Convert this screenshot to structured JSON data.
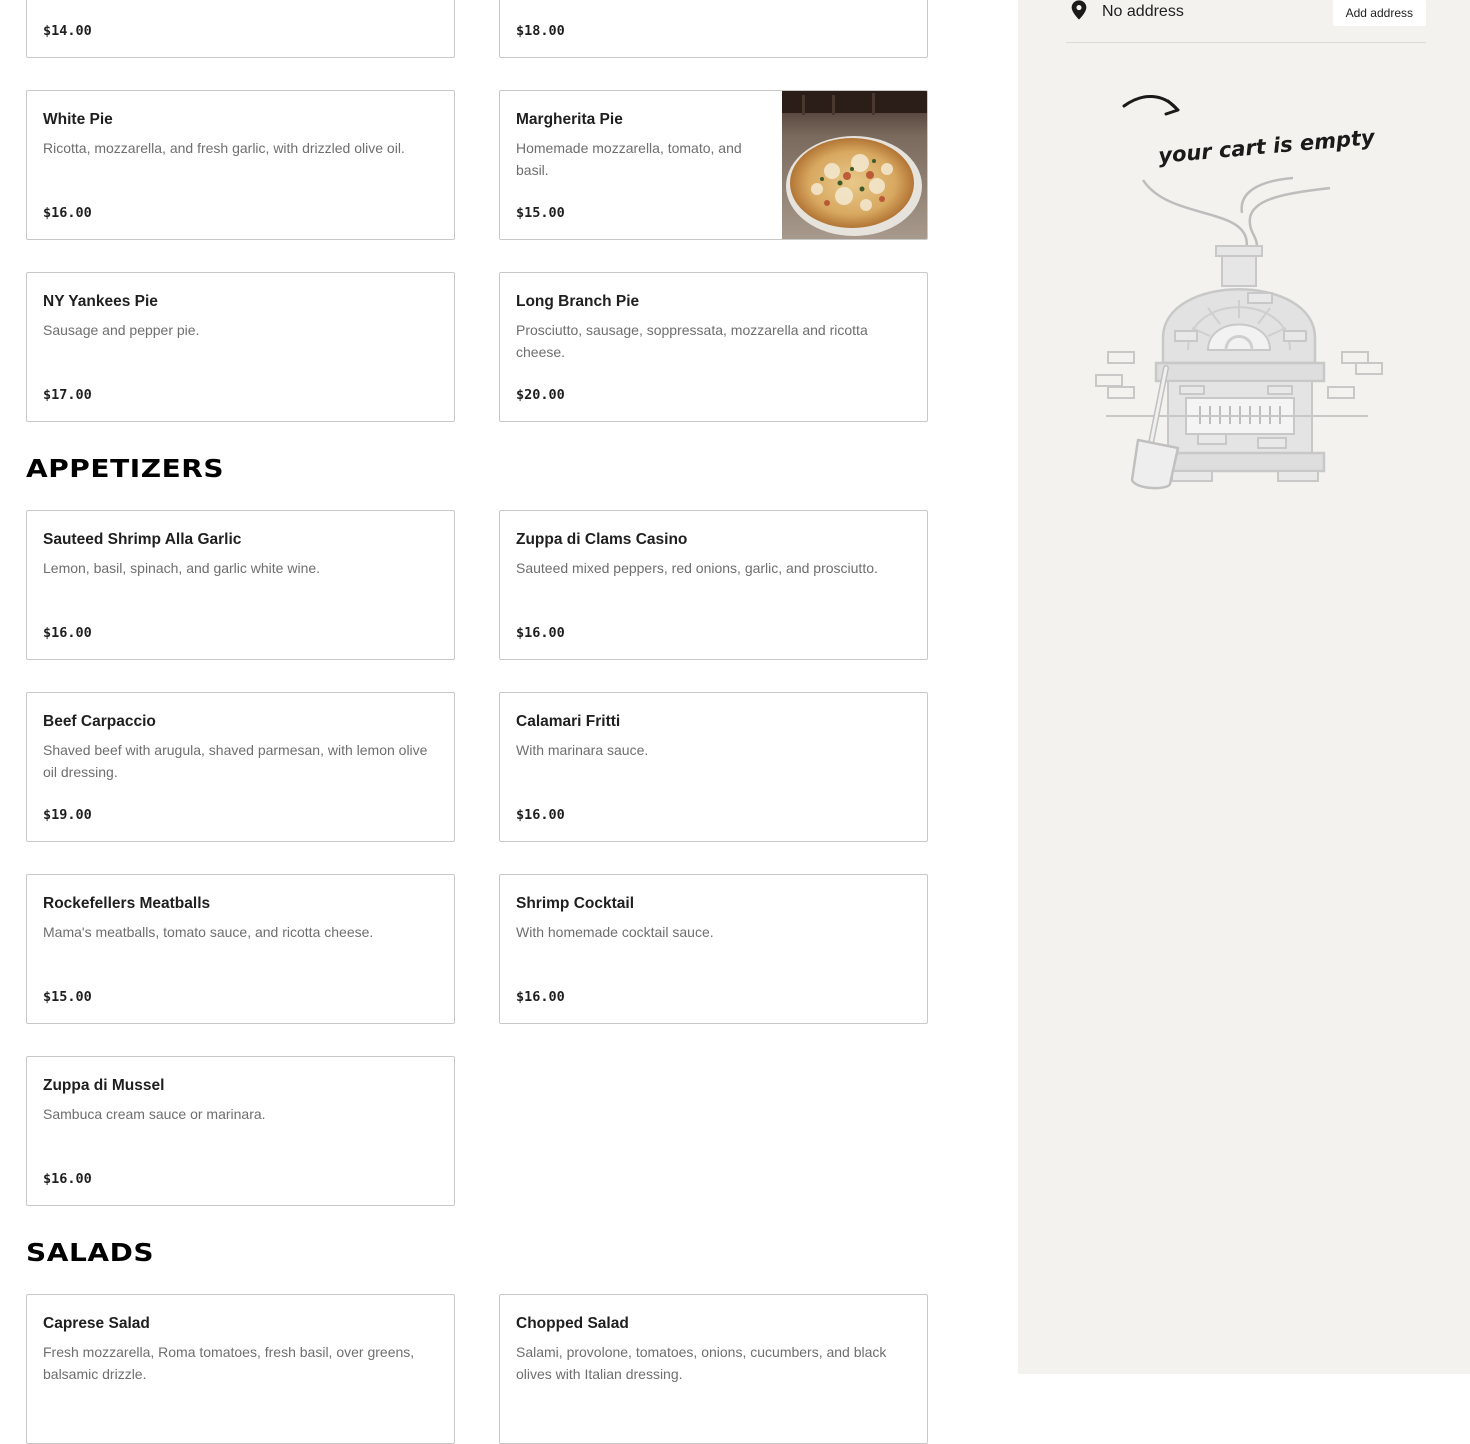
{
  "top_row": [
    {
      "price": "$14.00"
    },
    {
      "price": "$18.00"
    }
  ],
  "pies": [
    {
      "name": "White Pie",
      "desc": "Ricotta, mozzarella, and fresh garlic, with drizzled olive oil.",
      "price": "$16.00"
    },
    {
      "name": "Margherita Pie",
      "desc": "Homemade mozzarella, tomato, and basil.",
      "price": "$15.00",
      "image": "pizza-photo"
    },
    {
      "name": "NY Yankees Pie",
      "desc": "Sausage and pepper pie.",
      "price": "$17.00"
    },
    {
      "name": "Long Branch Pie",
      "desc": "Prosciutto, sausage, soppressata, mozzarella and ricotta cheese.",
      "price": "$20.00"
    }
  ],
  "appetizers": {
    "title": "APPETIZERS",
    "items": [
      {
        "name": "Sauteed Shrimp Alla Garlic",
        "desc": "Lemon, basil, spinach, and garlic white wine.",
        "price": "$16.00"
      },
      {
        "name": "Zuppa di Clams Casino",
        "desc": "Sauteed mixed peppers, red onions, garlic, and prosciutto.",
        "price": "$16.00"
      },
      {
        "name": "Beef Carpaccio",
        "desc": "Shaved beef with arugula, shaved parmesan, with lemon olive oil dressing.",
        "price": "$19.00"
      },
      {
        "name": "Calamari Fritti",
        "desc": "With marinara sauce.",
        "price": "$16.00"
      },
      {
        "name": "Rockefellers Meatballs",
        "desc": "Mama's meatballs, tomato sauce, and ricotta cheese.",
        "price": "$15.00"
      },
      {
        "name": "Shrimp Cocktail",
        "desc": "With homemade cocktail sauce.",
        "price": "$16.00"
      },
      {
        "name": "Zuppa di Mussel",
        "desc": "Sambuca cream sauce or marinara.",
        "price": "$16.00"
      }
    ]
  },
  "salads": {
    "title": "SALADS",
    "items": [
      {
        "name": "Caprese Salad",
        "desc": "Fresh mozzarella, Roma tomatoes, fresh basil, over greens, balsamic drizzle.",
        "price": ""
      },
      {
        "name": "Chopped Salad",
        "desc": "Salami, provolone, tomatoes, onions, cucumbers, and black olives with Italian dressing.",
        "price": ""
      }
    ]
  },
  "sidebar": {
    "address_text": "No address",
    "address_button": "Add address",
    "pin_icon": "map-pin-icon",
    "empty_cart_text": "your cart is empty",
    "illustration": "pizza-oven-illustration"
  },
  "colors": {
    "sidebar_bg": "#f3f2ef",
    "card_border": "#c9c9c9",
    "desc_text": "#6e6e6e"
  }
}
